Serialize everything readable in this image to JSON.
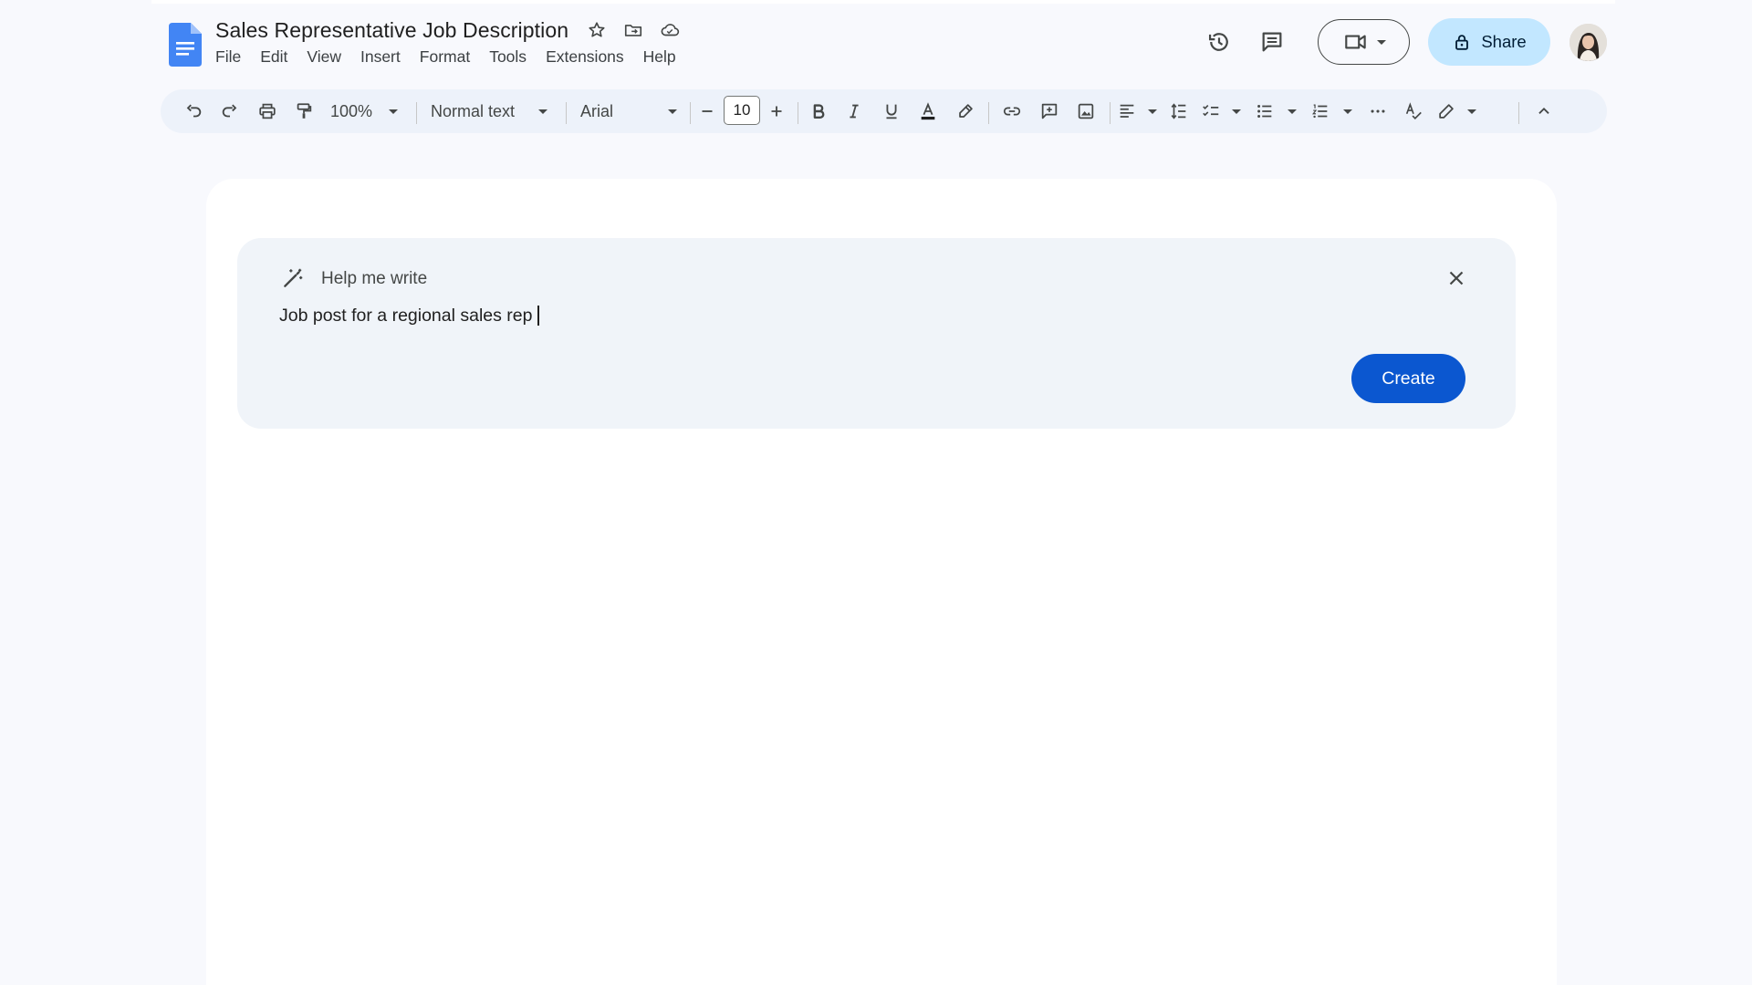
{
  "document": {
    "title": "Sales Representative Job Description"
  },
  "menu": [
    "File",
    "Edit",
    "View",
    "Insert",
    "Format",
    "Tools",
    "Extensions",
    "Help"
  ],
  "header": {
    "share_label": "Share"
  },
  "toolbar": {
    "zoom": "100%",
    "style": "Normal text",
    "font": "Arial",
    "font_size": "10"
  },
  "help_me_write": {
    "label": "Help me write",
    "prompt_text": "Job post for a regional sales rep",
    "create_label": "Create"
  },
  "colors": {
    "accent": "#0b57d0",
    "share_bg": "#c2e7ff",
    "toolbar_bg": "#edf2fa",
    "panel_bg": "#f0f4f9",
    "docs_blue": "#4285f4"
  },
  "icons": [
    "docs-logo-icon",
    "star-icon",
    "move-folder-icon",
    "cloud-icon",
    "history-icon",
    "comments-icon",
    "video-call-icon",
    "lock-icon",
    "undo-icon",
    "redo-icon",
    "print-icon",
    "paint-format-icon",
    "minus-icon",
    "plus-icon",
    "bold-icon",
    "italic-icon",
    "underline-icon",
    "text-color-icon",
    "highlight-icon",
    "link-icon",
    "add-comment-icon",
    "image-icon",
    "align-icon",
    "line-spacing-icon",
    "checklist-icon",
    "bulleted-list-icon",
    "numbered-list-icon",
    "more-icon",
    "spellcheck-icon",
    "editing-mode-icon",
    "collapse-icon",
    "magic-wand-icon",
    "close-icon"
  ]
}
